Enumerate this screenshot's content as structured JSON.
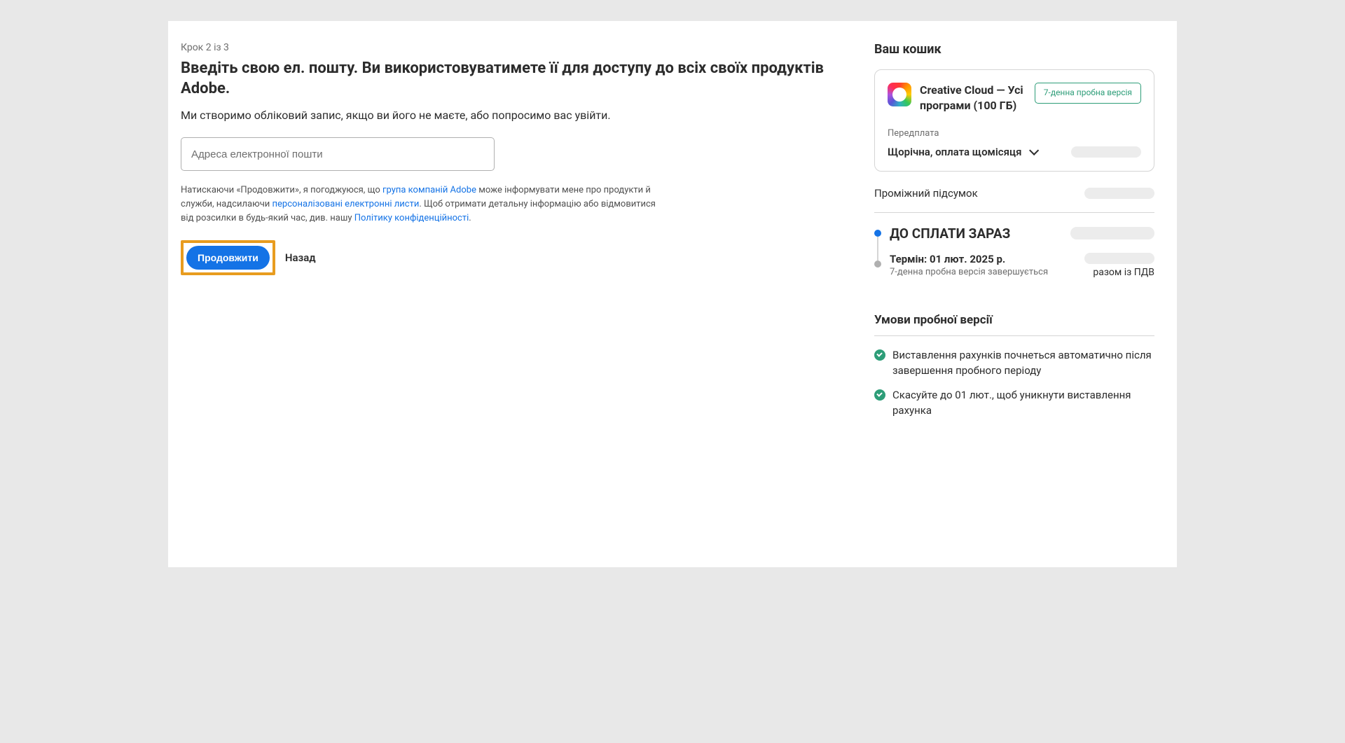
{
  "step_label": "Крок 2 із 3",
  "heading": "Введіть свою ел. пошту. Ви використовуватимете її для доступу до всіх своїх продуктів Adobe.",
  "subheading": "Ми створимо обліковий запис, якщо ви його не маєте, або попросимо вас увійти.",
  "email_placeholder": "Адреса електронної пошти",
  "consent": {
    "part1": "Натискаючи «Продовжити», я погоджуюся, що ",
    "link1": "група компаній Adobe",
    "part2": " може інформувати мене про продукти й служби, надсилаючи ",
    "link2": "персоналізовані електронні листи",
    "part3": ". Щоб отримати детальну інформацію або відмовитися від розсилки в будь-який час, див. нашу ",
    "link3": "Політику конфіденційності",
    "part4": "."
  },
  "continue_label": "Продовжити",
  "back_label": "Назад",
  "cart": {
    "title": "Ваш кошик",
    "product_name": "Creative Cloud — Усі програми (100 ГБ)",
    "trial_badge": "7-денна пробна версія",
    "subscription_label": "Передплата",
    "subscription_value": "Щорічна, оплата щомісяця",
    "subtotal_label": "Проміжний підсумок",
    "due_now_label": "ДО СПЛАТИ ЗАРАЗ",
    "due_later_label": "Термін: 01 лют. 2025 р.",
    "due_later_sub": "7-денна пробна версія завершується",
    "vat_text": "разом із ПДВ",
    "terms_title": "Умови пробної версії",
    "term1": "Виставлення рахунків почнеться автоматично після завершення пробного періоду",
    "term2": "Скасуйте до 01 лют., щоб уникнути виставлення рахунка"
  }
}
